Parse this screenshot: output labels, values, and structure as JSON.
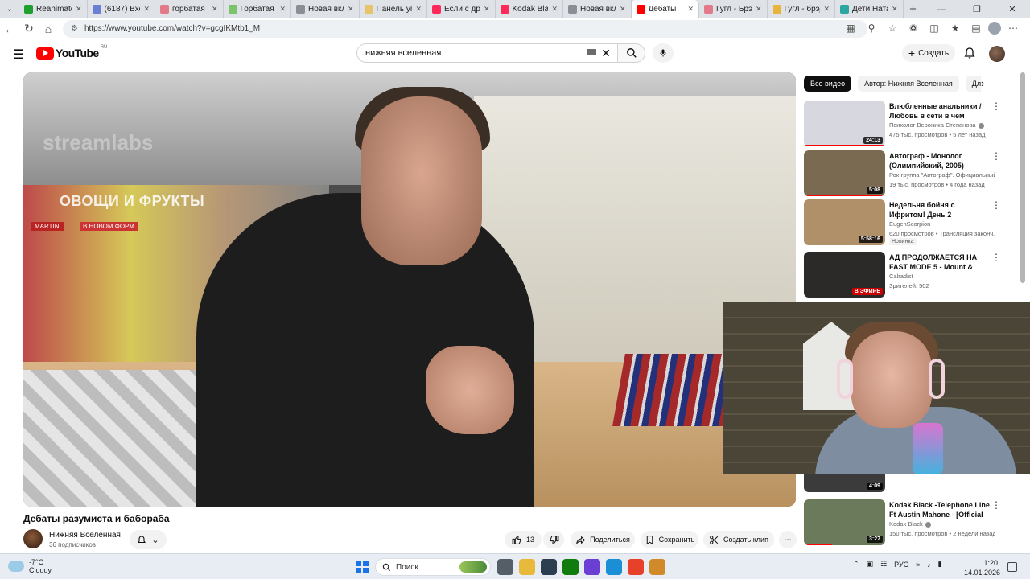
{
  "browser": {
    "tabs": [
      {
        "title": "ReanimatoR",
        "color": "#1fa02e",
        "active": false
      },
      {
        "title": "(6187) Входя",
        "color": "#6a7fd4",
        "active": false
      },
      {
        "title": "горбатая гор",
        "color": "#e27a8a",
        "active": false
      },
      {
        "title": "Горбатая Го",
        "color": "#7bc46c",
        "active": false
      },
      {
        "title": "Новая вклад",
        "color": "#8a8f96",
        "active": false
      },
      {
        "title": "Панель упр",
        "color": "#e7c46c",
        "active": false
      },
      {
        "title": "Если с друг",
        "color": "#ff2a5a",
        "active": false
      },
      {
        "title": "Kodak Black",
        "color": "#ff2a5a",
        "active": false
      },
      {
        "title": "Новая вклад",
        "color": "#8a8f96",
        "active": false
      },
      {
        "title": "Дебаты",
        "color": "#ff0000",
        "active": true
      },
      {
        "title": "Гугл - Брэд",
        "color": "#e27a8a",
        "active": false
      },
      {
        "title": "Гугл - брэд",
        "color": "#e7b53c",
        "active": false
      },
      {
        "title": "Дети Натал",
        "color": "#2aa7a0",
        "active": false
      }
    ],
    "url": "https://www.youtube.com/watch?v=gcgIKMtb1_M"
  },
  "youtube": {
    "logo_text": "YouTube",
    "logo_region": "RU",
    "search_value": "нижняя вселенная",
    "create_label": "Создать"
  },
  "video": {
    "watermark": "streamlabs",
    "store_sign": "ОВОЩИ И ФРУКТЫ",
    "sign_martini": "MARTINI",
    "sign_promo": "В НОВОМ ФОРМ",
    "title": "Дебаты разумиста и бабораба",
    "channel": "Нижняя Вселенная",
    "subscribers": "36 подписчиков",
    "likes": "13",
    "share_label": "Поделиться",
    "save_label": "Сохранить",
    "clip_label": "Создать клип"
  },
  "sidebar": {
    "chips": [
      "Все видео",
      "Автор: Нижняя Вселенная",
      "Для вас"
    ],
    "recommendations": [
      {
        "title": "Влюбленные анальники / Любовь в сети в чем подвох...",
        "channel": "Психолог Вероника Степанова",
        "meta": "475 тыс. просмотров • 5 лет назад",
        "duration": "24:13",
        "verified": true,
        "thumb": "#d7d7df",
        "progress": 1.0
      },
      {
        "title": "Автограф - Монолог (Олимпийский, 2005)",
        "channel": "Рок-группа \"Автограф\". Официальный ...",
        "meta": "19 тыс. просмотров • 4 года назад",
        "duration": "5:08",
        "verified": false,
        "thumb": "#7a6a52",
        "progress": 1.0
      },
      {
        "title": "Недельня бойня с Ифритом! День 2",
        "channel": "EugenScorpion",
        "meta": "620 просмотров • Трансляция законч...",
        "duration": "5:58:16",
        "badge": "Новинка",
        "verified": false,
        "thumb": "#b09068",
        "progress": 0
      },
      {
        "title": "АД ПРОДОЛЖАЕТСЯ НА FAST MODE 5 - Mount & Blade II: ...",
        "channel": "Calradist",
        "meta": "Зрителей: 502",
        "duration": "В ЭФИРЕ",
        "live": true,
        "verified": false,
        "thumb": "#2c2a28",
        "progress": 0
      },
      {
        "title": "Kodak Black -Telephone Line Ft Austin Mahone - [Official Musi...",
        "channel": "Kodak Black",
        "meta": "150 тыс. просмотров • 2 недели назад",
        "duration": "3:27",
        "verified": true,
        "thumb": "#6a7a5a",
        "progress": 0.35
      }
    ],
    "partial_duration": "4:09"
  },
  "taskbar": {
    "temperature": "-7°C",
    "condition": "Cloudy",
    "search_label": "Поиск",
    "lang": "РУС",
    "time": "1:20",
    "date": "14.01.2026",
    "app_colors": [
      "#555d66",
      "#e8b93a",
      "#2c3e50",
      "#107c10",
      "#6b3fd4",
      "#1a8fd6",
      "#e8412a",
      "#d08a2a"
    ]
  }
}
